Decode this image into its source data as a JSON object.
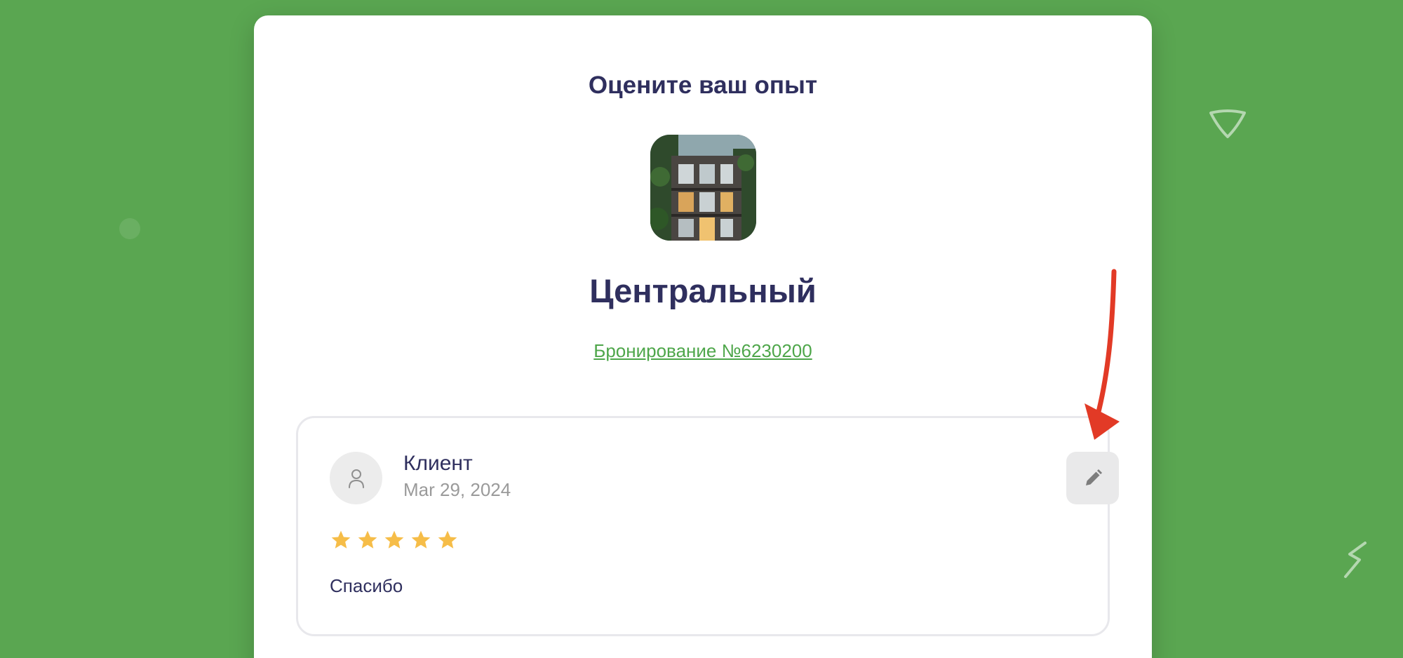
{
  "header": {
    "title": "Оцените ваш опыт"
  },
  "hotel": {
    "name": "Центральный",
    "image_icon": "building-photo",
    "booking_link": "Бронирование №6230200"
  },
  "review": {
    "author": "Клиент",
    "date": "Mar 29, 2024",
    "rating": 5,
    "rating_max": 5,
    "text": "Спасибо",
    "avatar_icon": "user-icon",
    "edit_icon": "pencil-icon"
  },
  "colors": {
    "background": "#5aa651",
    "card": "#ffffff",
    "heading": "#2f2f5e",
    "link": "#4ea64a",
    "star": "#f6bd48",
    "muted": "#9a9a9a",
    "annotation": "#e23a26"
  }
}
